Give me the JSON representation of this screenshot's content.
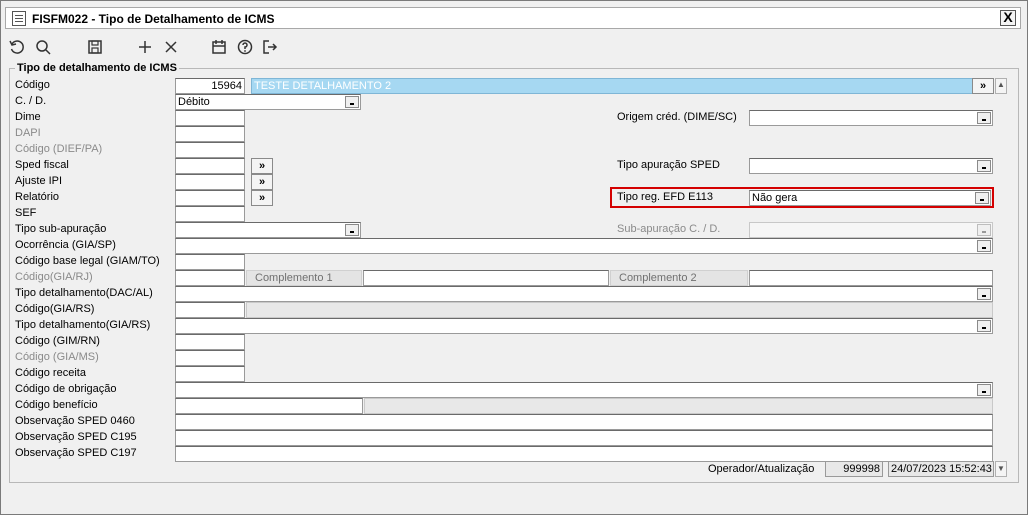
{
  "window": {
    "title": "FISFM022 - Tipo de Detalhamento de ICMS",
    "close_label": "X"
  },
  "group": {
    "title": "Tipo de detalhamento de ICMS"
  },
  "fields": {
    "codigo": {
      "label": "Código",
      "value": "15964",
      "description": "TESTE DETALHAMENTO 2"
    },
    "cd": {
      "label": "C. / D.",
      "value": "Débito"
    },
    "dime": {
      "label": "Dime",
      "value": ""
    },
    "dapi": {
      "label": "DAPI",
      "value": ""
    },
    "codigo_dief": {
      "label": "Código (DIEF/PA)",
      "value": ""
    },
    "sped_fiscal": {
      "label": "Sped fiscal",
      "value": ""
    },
    "ajuste_ipi": {
      "label": "Ajuste IPI",
      "value": ""
    },
    "relatorio": {
      "label": "Relatório",
      "value": ""
    },
    "sef": {
      "label": "SEF",
      "value": ""
    },
    "tipo_sub_apuracao": {
      "label": "Tipo sub-apuração",
      "value": ""
    },
    "ocorrencia_gia_sp": {
      "label": "Ocorrência (GIA/SP)",
      "value": ""
    },
    "codigo_base_legal": {
      "label": "Código base legal (GIAM/TO)",
      "value": ""
    },
    "codigo_gia_rj": {
      "label": "Código(GIA/RJ)",
      "value": ""
    },
    "tipo_det_dac_al": {
      "label": "Tipo detalhamento(DAC/AL)",
      "value": ""
    },
    "codigo_gia_rs": {
      "label": "Código(GIA/RS)",
      "value": ""
    },
    "tipo_det_gia_rs": {
      "label": "Tipo detalhamento(GIA/RS)",
      "value": ""
    },
    "codigo_gim_rn": {
      "label": "Código (GIM/RN)",
      "value": ""
    },
    "codigo_gia_ms": {
      "label": "Código (GIA/MS)",
      "value": ""
    },
    "codigo_receita": {
      "label": "Código receita",
      "value": ""
    },
    "codigo_obrigacao": {
      "label": "Código de obrigação",
      "value": ""
    },
    "codigo_beneficio": {
      "label": "Código benefício",
      "value": ""
    },
    "obs_sped_0460": {
      "label": "Observação SPED 0460",
      "value": ""
    },
    "obs_sped_c195": {
      "label": "Observação SPED C195",
      "value": ""
    },
    "obs_sped_c197": {
      "label": "Observação SPED C197",
      "value": ""
    },
    "origem_cred": {
      "label": "Origem créd. (DIME/SC)",
      "value": ""
    },
    "tipo_apuracao_sped": {
      "label": "Tipo apuração SPED",
      "value": ""
    },
    "tipo_reg_efd": {
      "label": "Tipo reg. EFD E113",
      "value": "Não gera"
    },
    "sub_apuracao_cd": {
      "label": "Sub-apuração C. / D.",
      "value": ""
    },
    "complemento1": {
      "label": "Complemento 1",
      "value": ""
    },
    "complemento2": {
      "label": "Complemento 2",
      "value": ""
    }
  },
  "lookup_label": "»",
  "footer": {
    "label": "Operador/Atualização",
    "operator": "999998",
    "timestamp": "24/07/2023 15:52:43"
  },
  "colors": {
    "highlight": "#a6d8f2",
    "required_box": "#d40000"
  }
}
